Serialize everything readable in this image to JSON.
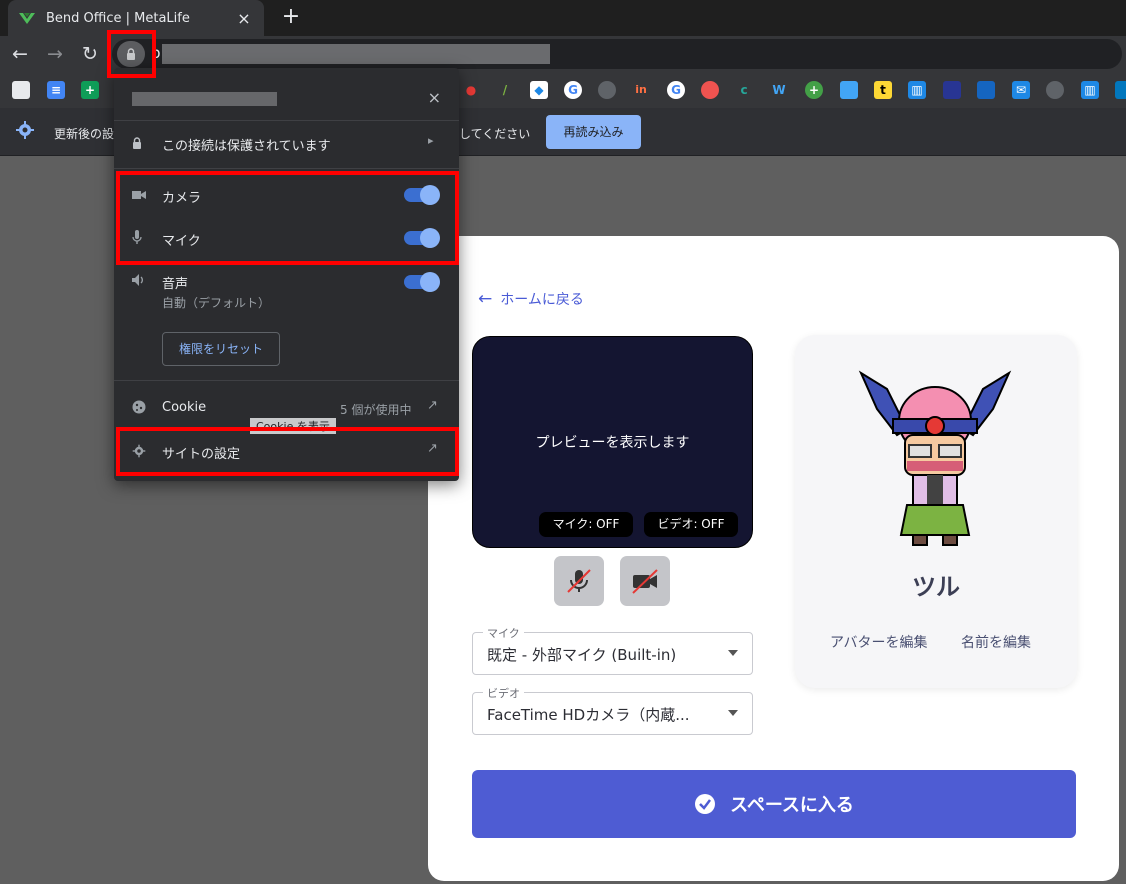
{
  "browser": {
    "tab_title": "Bend Office | MetaLife",
    "tab_close": "×",
    "new_tab": "+",
    "url_visible_char": "p"
  },
  "infobar": {
    "text_left": "更新後の設",
    "text_right": "してください",
    "reload_label": "再読み込み"
  },
  "popup": {
    "close": "×",
    "connection_label": "この接続は保護されています",
    "permissions": [
      {
        "label": "カメラ",
        "enabled": true
      },
      {
        "label": "マイク",
        "enabled": true
      },
      {
        "label": "音声",
        "sub": "自動（デフォルト）",
        "enabled": true
      }
    ],
    "reset_label": "権限をリセット",
    "cookie_label": "Cookie",
    "cookie_count": "5 個が使用中",
    "tooltip": "Cookie を表示",
    "site_settings_label": "サイトの設定"
  },
  "page": {
    "back_label": "ホームに戻る",
    "preview_text": "プレビューを表示します",
    "mic_status": "マイク: OFF",
    "video_status": "ビデオ: OFF",
    "mic_field": {
      "label": "マイク",
      "value": "既定 - 外部マイク (Built-in)"
    },
    "video_field": {
      "label": "ビデオ",
      "value": "FaceTime HDカメラ（内蔵..."
    },
    "avatar_name": "ツル",
    "edit_avatar": "アバターを編集",
    "edit_name": "名前を編集",
    "enter_label": "スペースに入る"
  },
  "colors": {
    "accent": "#4e5cd3",
    "toggle_on": "#8ab4f8",
    "highlight": "#ff0000"
  }
}
